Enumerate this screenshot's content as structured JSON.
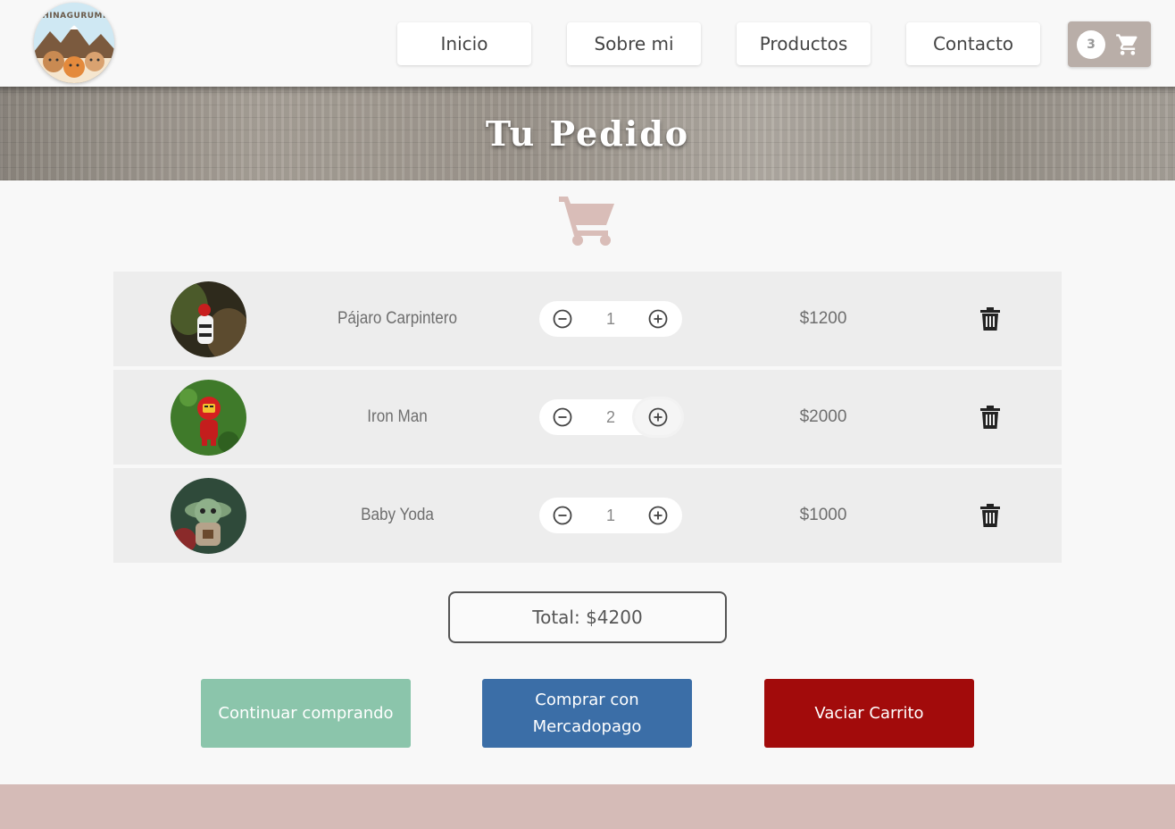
{
  "logo": {
    "text": "CHINAGURUMIS"
  },
  "nav": {
    "items": [
      "Inicio",
      "Sobre mi",
      "Productos",
      "Contacto"
    ],
    "cart_count": "3"
  },
  "banner": {
    "title": "Tu Pedido"
  },
  "cart": {
    "items": [
      {
        "name": "Pájaro Carpintero",
        "quantity": "1",
        "price": "$1200"
      },
      {
        "name": "Iron Man",
        "quantity": "2",
        "price": "$2000"
      },
      {
        "name": "Baby Yoda",
        "quantity": "1",
        "price": "$1000"
      }
    ],
    "total": "Total: $4200"
  },
  "actions": {
    "continue": "Continuar comprando",
    "mercadopago": "Comprar con Mercadopago",
    "empty": "Vaciar Carrito"
  },
  "colors": {
    "continue": "#8bc5ab",
    "mercadopago": "#3b6ea7",
    "empty": "#a20b0b",
    "footer": "#d5bbb7",
    "cart_icon": "#d9bdb8"
  }
}
